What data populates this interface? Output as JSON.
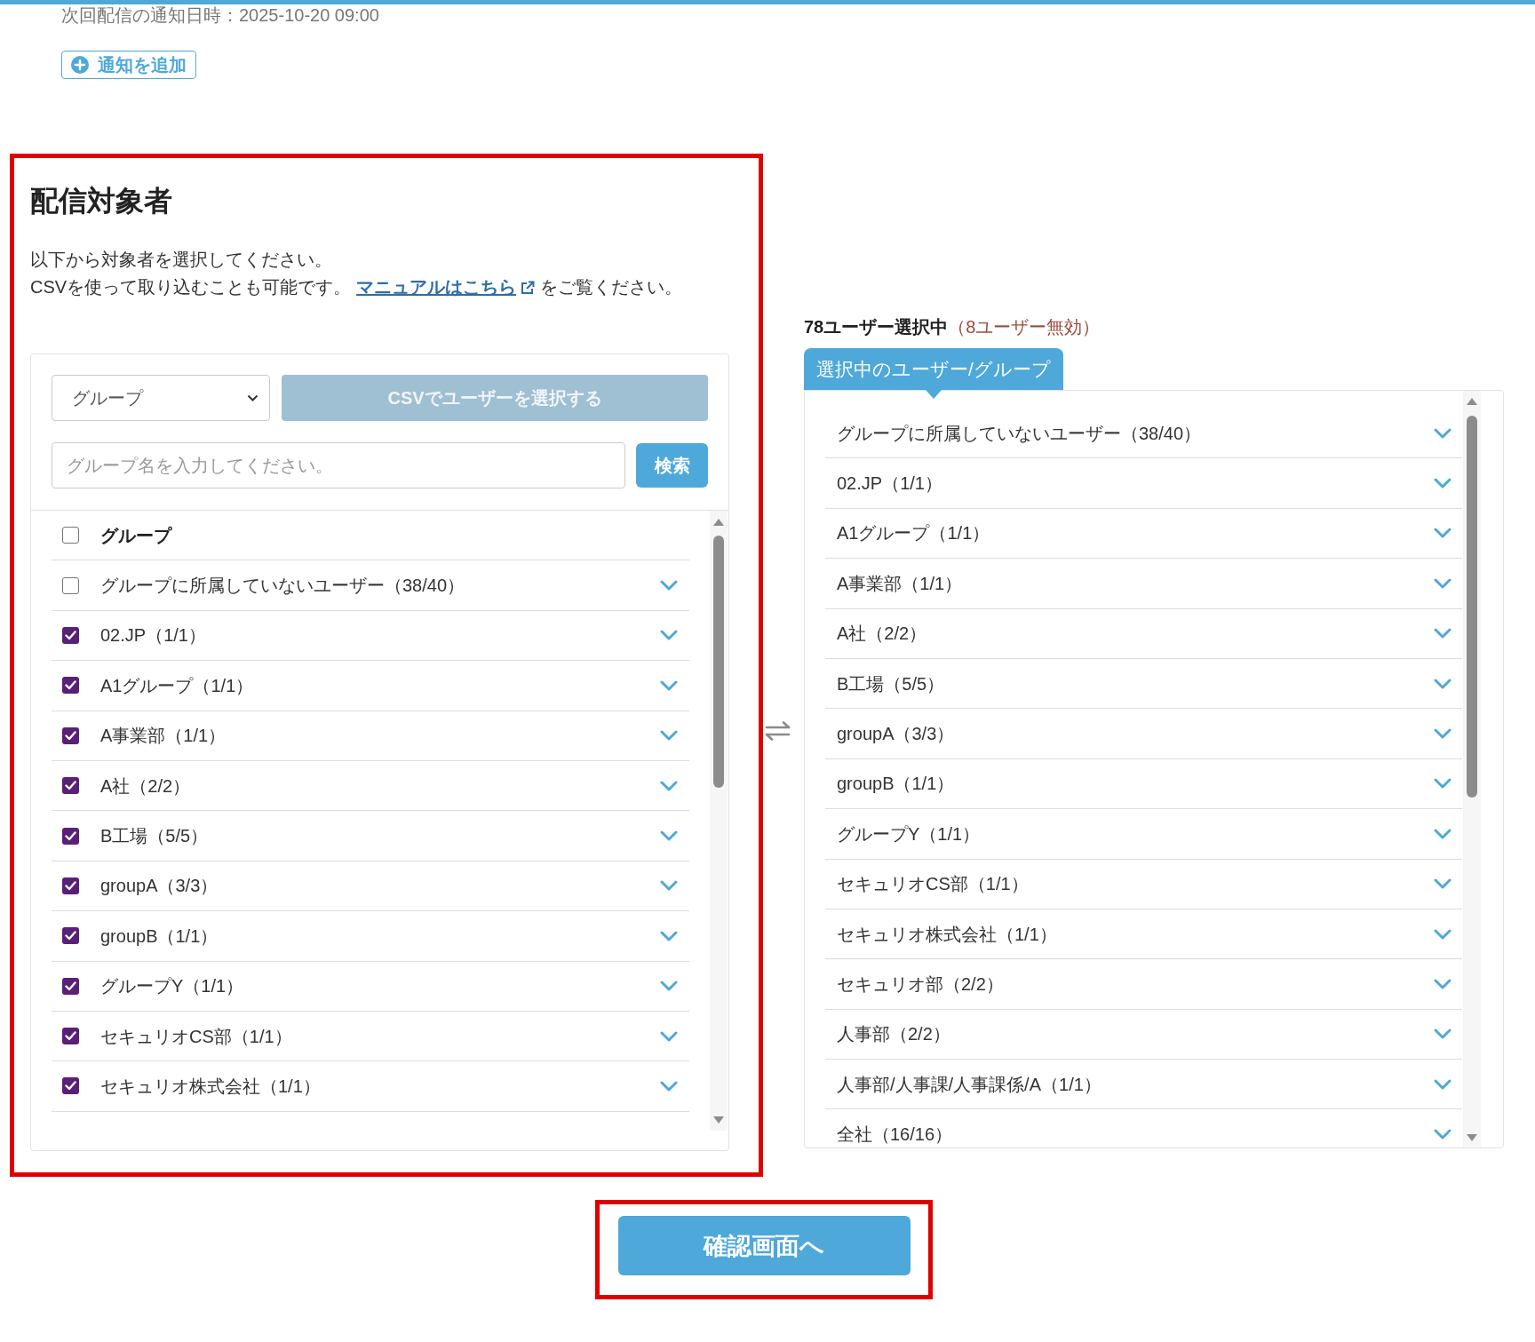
{
  "header": {
    "notice": "次回配信の通知日時：2025-10-20 09:00",
    "add_button": "通知を追加"
  },
  "recipients": {
    "title": "配信対象者",
    "description": {
      "line_1": "以下から対象者を選択してください。",
      "line_2": "CSVを使って取り込むことも可能です。",
      "link": "マニュアルはこちら",
      "line_2_end": "をご覧ください。"
    }
  },
  "filter": {
    "type_select": {
      "value": "グループ"
    },
    "csv_button": {
      "label": "CSVでユーザーを選択する",
      "disabled": true
    },
    "search": {
      "placeholder": "グループ名を入力してください。"
    },
    "search_button": {
      "label": "検索"
    }
  },
  "group_list": {
    "header": {
      "label": "グループ",
      "checked": false
    },
    "items": [
      {
        "label": "グループに所属していないユーザー（38/40）",
        "checked": false
      },
      {
        "label": "02.JP（1/1）",
        "checked": true
      },
      {
        "label": "A1グループ（1/1）",
        "checked": true
      },
      {
        "label": "A事業部（1/1）",
        "checked": true
      },
      {
        "label": "A社（2/2）",
        "checked": true
      },
      {
        "label": "B工場（5/5）",
        "checked": true
      },
      {
        "label": "groupA（3/3）",
        "checked": true
      },
      {
        "label": "groupB（1/1）",
        "checked": true
      },
      {
        "label": "グループY（1/1）",
        "checked": true
      },
      {
        "label": "セキュリオCS部（1/1）",
        "checked": true
      },
      {
        "label": "セキュリオ株式会社（1/1）",
        "checked": true
      }
    ]
  },
  "selection": {
    "count": "78ユーザー選択中",
    "invalid": "（8ユーザー無効）",
    "tab": {
      "label": "選択中のユーザー/グループ",
      "selected": true
    },
    "items": [
      {
        "label": "グループに所属していないユーザー（38/40）"
      },
      {
        "label": "02.JP（1/1）"
      },
      {
        "label": "A1グループ（1/1）"
      },
      {
        "label": "A事業部（1/1）"
      },
      {
        "label": "A社（2/2）"
      },
      {
        "label": "B工場（5/5）"
      },
      {
        "label": "groupA（3/3）"
      },
      {
        "label": "groupB（1/1）"
      },
      {
        "label": "グループY（1/1）"
      },
      {
        "label": "セキュリオCS部（1/1）"
      },
      {
        "label": "セキュリオ株式会社（1/1）"
      },
      {
        "label": "セキュリオ部（2/2）"
      },
      {
        "label": "人事部（2/2）"
      },
      {
        "label": "人事部/人事課/人事課係/A（1/1）"
      },
      {
        "label": "全社（16/16）"
      }
    ]
  },
  "confirm_button": {
    "label": "確認画面へ"
  }
}
